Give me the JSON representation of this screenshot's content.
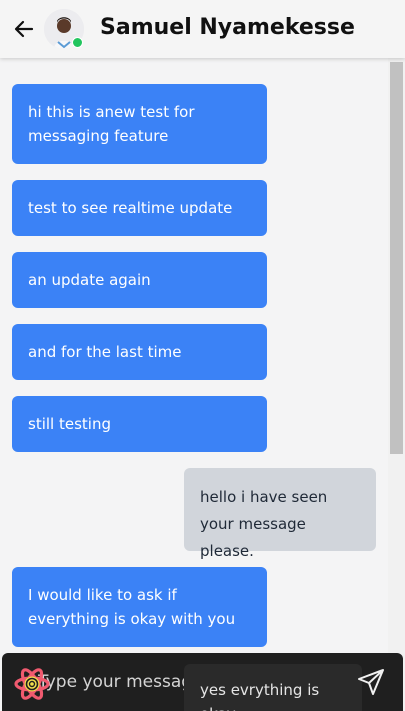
{
  "header": {
    "contact_name": "Samuel Nyamekesse",
    "status_color": "#22c55e"
  },
  "messages": [
    {
      "direction": "received",
      "text": "hi this is anew test for messaging feature"
    },
    {
      "direction": "received",
      "text": "test to see realtime update"
    },
    {
      "direction": "received",
      "text": "an update again"
    },
    {
      "direction": "received",
      "text": "and for the last time"
    },
    {
      "direction": "received",
      "text": "still testing"
    },
    {
      "direction": "sent",
      "text": "hello i have seen your message please."
    },
    {
      "direction": "received",
      "text": "I would like to ask if everything is okay with you"
    },
    {
      "direction": "sent",
      "text": "yes evrything is okay"
    }
  ],
  "composer": {
    "placeholder": "Type your message...",
    "peek_text": "yes evrything is okay"
  },
  "colors": {
    "received_bubble": "#3b82f6",
    "sent_bubble": "#d1d5db",
    "composer_bg": "#1f1f1f"
  },
  "icons": {
    "back": "arrow-left-icon",
    "send": "send-icon",
    "logo": "brand-logo-icon"
  }
}
